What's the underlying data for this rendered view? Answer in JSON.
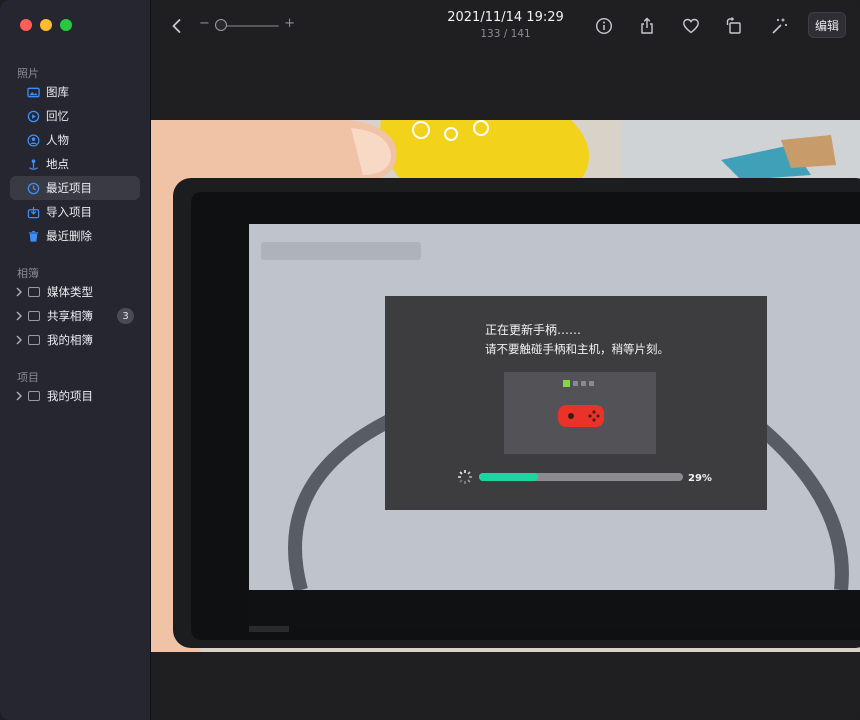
{
  "sidebar": {
    "section_photos": "照片",
    "items": [
      {
        "label": "图库",
        "icon": "photo-library-icon"
      },
      {
        "label": "回忆",
        "icon": "memories-icon"
      },
      {
        "label": "人物",
        "icon": "people-icon"
      },
      {
        "label": "地点",
        "icon": "places-icon"
      },
      {
        "label": "最近项目",
        "icon": "recents-icon",
        "active": true
      },
      {
        "label": "导入项目",
        "icon": "imports-icon"
      },
      {
        "label": "最近删除",
        "icon": "trash-icon"
      }
    ],
    "section_albums": "相簿",
    "albums": [
      {
        "label": "媒体类型"
      },
      {
        "label": "共享相簿",
        "badge": "3"
      },
      {
        "label": "我的相簿"
      }
    ],
    "section_projects": "项目",
    "projects": [
      {
        "label": "我的项目"
      }
    ]
  },
  "toolbar": {
    "date": "2021/11/14 19:29",
    "counter": "133 / 141",
    "zoom_minus": "−",
    "zoom_plus": "+",
    "edit_label": "编辑"
  },
  "photo": {
    "dialog_line1": "正在更新手柄……",
    "dialog_line2": "请不要触碰手柄和主机，稍等片刻。",
    "progress_text": "29%",
    "progress": 0.29
  }
}
